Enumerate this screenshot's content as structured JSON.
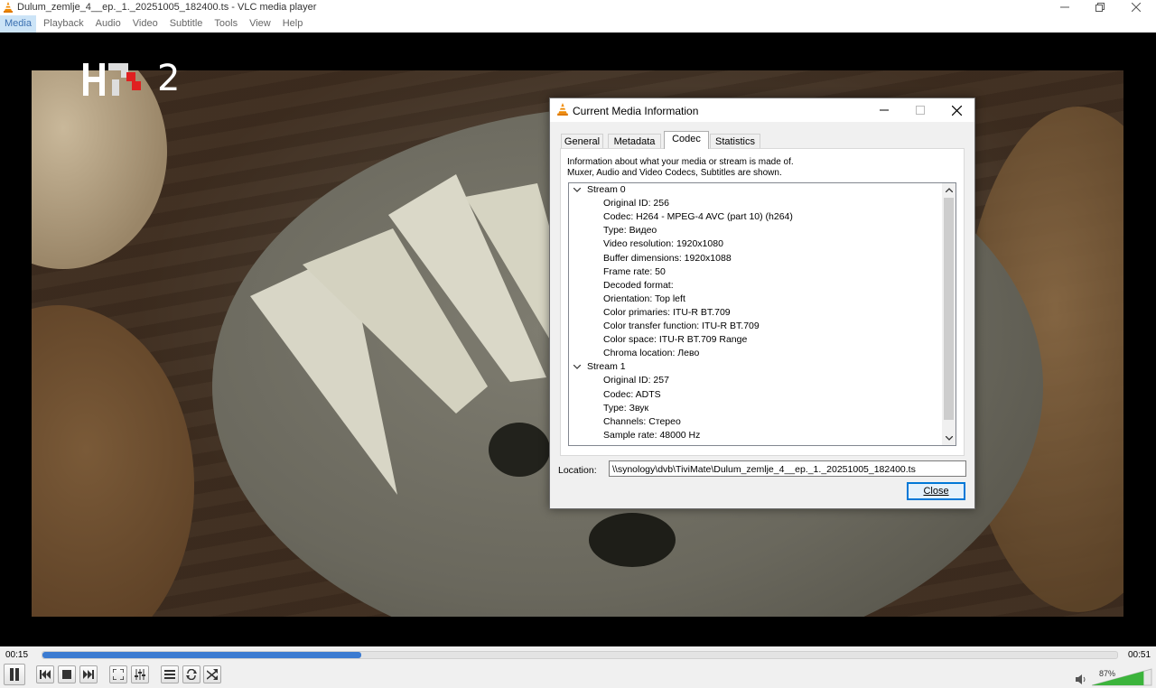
{
  "window": {
    "title": "Dulum_zemlje_4__ep._1._20251005_182400.ts - VLC media player"
  },
  "menu": {
    "items": [
      "Media",
      "Playback",
      "Audio",
      "Video",
      "Subtitle",
      "Tools",
      "View",
      "Help"
    ],
    "active": "Media"
  },
  "video": {
    "channel_logo": "HRT 2",
    "channel_number": "2"
  },
  "player": {
    "time_elapsed": "00:15",
    "time_total": "00:51",
    "progress_fraction": 0.297,
    "volume_label": "87%",
    "volume_fraction": 0.87,
    "accent_color": "#3b7bd1",
    "buttons": [
      "pause-icon",
      "previous-icon",
      "stop-icon",
      "next-icon",
      "fullscreen-icon",
      "extended-settings-icon",
      "playlist-icon",
      "loop-icon",
      "shuffle-icon",
      "speaker-icon"
    ]
  },
  "dialog": {
    "title": "Current Media Information",
    "tabs": [
      "General",
      "Metadata",
      "Codec",
      "Statistics"
    ],
    "active_tab": "Codec",
    "description_line1": "Information about what your media or stream is made of.",
    "description_line2": "Muxer, Audio and Video Codecs, Subtitles are shown.",
    "streams": [
      {
        "label": "Stream 0",
        "fields": [
          "Original ID: 256",
          "Codec: H264 - MPEG-4 AVC (part 10) (h264)",
          "Type: Видео",
          "Video resolution: 1920x1080",
          "Buffer dimensions: 1920x1088",
          "Frame rate: 50",
          "Decoded format:",
          "Orientation: Top left",
          "Color primaries: ITU-R BT.709",
          "Color transfer function: ITU-R BT.709",
          "Color space: ITU-R BT.709 Range",
          "Chroma location: Лево"
        ]
      },
      {
        "label": "Stream 1",
        "fields": [
          "Original ID: 257",
          "Codec: ADTS",
          "Type: Звук",
          "Channels: Стерео",
          "Sample rate: 48000 Hz"
        ]
      }
    ],
    "location_label": "Location:",
    "location_value": "\\\\synology\\dvb\\TiviMate\\Dulum_zemlje_4__ep._1._20251005_182400.ts",
    "close_label": "Close"
  }
}
